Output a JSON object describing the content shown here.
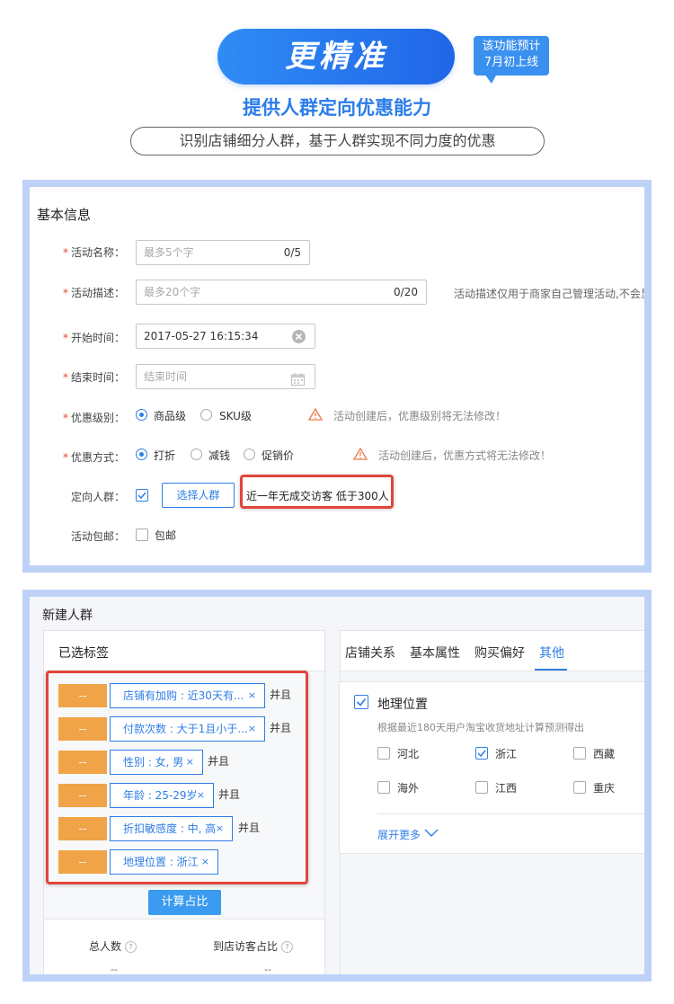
{
  "header": {
    "title": "更精准",
    "badge_line1": "该功能预计",
    "badge_line2": "7月初上线",
    "subtitle": "提供人群定向优惠能力",
    "description": "识别店铺细分人群，基于人群实现不同力度的优惠"
  },
  "form": {
    "section_title": "基本信息",
    "activity_name": {
      "label": "活动名称：",
      "placeholder": "最多5个字",
      "counter": "0/5"
    },
    "activity_desc": {
      "label": "活动描述：",
      "placeholder": "最多20个字",
      "counter": "0/20",
      "hint": "活动描述仅用于商家自己管理活动,不会显示"
    },
    "start_time": {
      "label": "开始时间：",
      "value": "2017-05-27 16:15:34"
    },
    "end_time": {
      "label": "结束时间：",
      "placeholder": "结束时间"
    },
    "discount_level": {
      "label": "优惠级别：",
      "options": [
        "商品级",
        "SKU级"
      ],
      "selected": "商品级",
      "warning": "活动创建后，优惠级别将无法修改！"
    },
    "discount_type": {
      "label": "优惠方式：",
      "options": [
        "打折",
        "减钱",
        "促销价"
      ],
      "selected": "打折",
      "warning": "活动创建后，优惠方式将无法修改！"
    },
    "target_group": {
      "label": "定向人群：",
      "button": "选择人群",
      "selected_text": "近一年无成交访客 低于300人"
    },
    "free_shipping": {
      "label": "活动包邮：",
      "checkbox_label": "包邮"
    }
  },
  "crowd": {
    "title": "新建人群",
    "selected_tags_title": "已选标签",
    "tags": [
      {
        "btn": "--",
        "text": "店铺有加购 : 近30天有...",
        "join": "并且"
      },
      {
        "btn": "--",
        "text": "付款次数 : 大于1且小于...",
        "join": "并且"
      },
      {
        "btn": "--",
        "text": "性别 : 女, 男",
        "join": "并且"
      },
      {
        "btn": "--",
        "text": "年龄 : 25-29岁",
        "join": "并且"
      },
      {
        "btn": "--",
        "text": "折扣敏感度 : 中, 高",
        "join": "并且"
      },
      {
        "btn": "--",
        "text": "地理位置 : 浙江",
        "join": ""
      }
    ],
    "tag_close": "×",
    "calc_button": "计算占比",
    "stats": [
      {
        "label": "总人数",
        "value": "--"
      },
      {
        "label": "到店访客占比",
        "value": "--"
      }
    ],
    "help_glyph": "?",
    "tabs": [
      "店铺关系",
      "基本属性",
      "购买偏好",
      "其他"
    ],
    "active_tab": "其他",
    "geo": {
      "title": "地理位置",
      "note": "根据最近180天用户淘宝收货地址计算预测得出",
      "options": [
        {
          "label": "河北",
          "checked": false
        },
        {
          "label": "浙江",
          "checked": true
        },
        {
          "label": "西藏",
          "checked": false
        },
        {
          "label": "海外",
          "checked": false
        },
        {
          "label": "江西",
          "checked": false
        },
        {
          "label": "重庆",
          "checked": false
        }
      ],
      "expand": "展开更多"
    }
  },
  "colors": {
    "accent": "#2f7ee6",
    "panel_border": "#bed2f7",
    "tag_orange": "#f0a347",
    "highlight_red": "#e0453a"
  }
}
